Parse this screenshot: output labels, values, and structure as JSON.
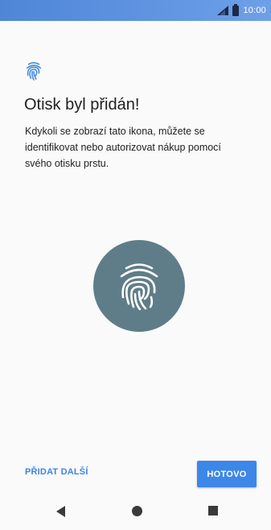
{
  "status_bar": {
    "time": "10:00",
    "icons": [
      "signal-icon",
      "battery-icon"
    ]
  },
  "content": {
    "icon": "fingerprint-icon",
    "title": "Otisk byl přidán!",
    "description": "Kdykoli se zobrazí tato ikona, můžete se identifikovat nebo autorizovat nákup pomocí svého otisku prstu.",
    "large_icon": "fingerprint-icon"
  },
  "actions": {
    "add_more_label": "PŘIDAT DALŠÍ",
    "done_label": "HOTOVO"
  },
  "nav_bar": {
    "icons": [
      "back-icon",
      "home-icon",
      "recents-icon"
    ]
  },
  "colors": {
    "accent": "#3d87e8",
    "status_bar": "#5b90df",
    "fingerprint_circle": "#5f7d88",
    "fingerprint_small": "#4a8ee0"
  }
}
